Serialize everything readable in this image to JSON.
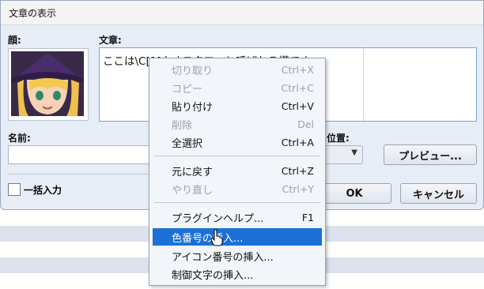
{
  "dialog": {
    "title": "文章の表示",
    "face_label": "顔:",
    "text_label": "文章:",
    "text_content": "ここは\\C[1]カオスタワーと呼ばれる塔です",
    "name_label": "名前:",
    "position_label": "位置:",
    "preview_button": "プレビュー...",
    "ok_button": "OK",
    "cancel_button": "キャンセル",
    "batch_checkbox_label": "一括入力"
  },
  "context_menu": {
    "items": [
      {
        "label": "切り取り",
        "shortcut": "Ctrl+X",
        "enabled": false
      },
      {
        "label": "コピー",
        "shortcut": "Ctrl+C",
        "enabled": false
      },
      {
        "label": "貼り付け",
        "shortcut": "Ctrl+V",
        "enabled": true
      },
      {
        "label": "削除",
        "shortcut": "Del",
        "enabled": false
      },
      {
        "label": "全選択",
        "shortcut": "Ctrl+A",
        "enabled": true
      },
      {
        "label": "元に戻す",
        "shortcut": "Ctrl+Z",
        "enabled": true
      },
      {
        "label": "やり直し",
        "shortcut": "Ctrl+Y",
        "enabled": false
      },
      {
        "label": "プラグインヘルプ...",
        "shortcut": "F1",
        "enabled": true
      },
      {
        "label": "色番号の挿入...",
        "shortcut": "",
        "enabled": true,
        "highlighted": true
      },
      {
        "label": "アイコン番号の挿入...",
        "shortcut": "",
        "enabled": true
      },
      {
        "label": "制御文字の挿入...",
        "shortcut": "",
        "enabled": true
      }
    ]
  },
  "colors": {
    "highlight": "#1b70d6",
    "dialog_bg": "#e6edf7"
  }
}
